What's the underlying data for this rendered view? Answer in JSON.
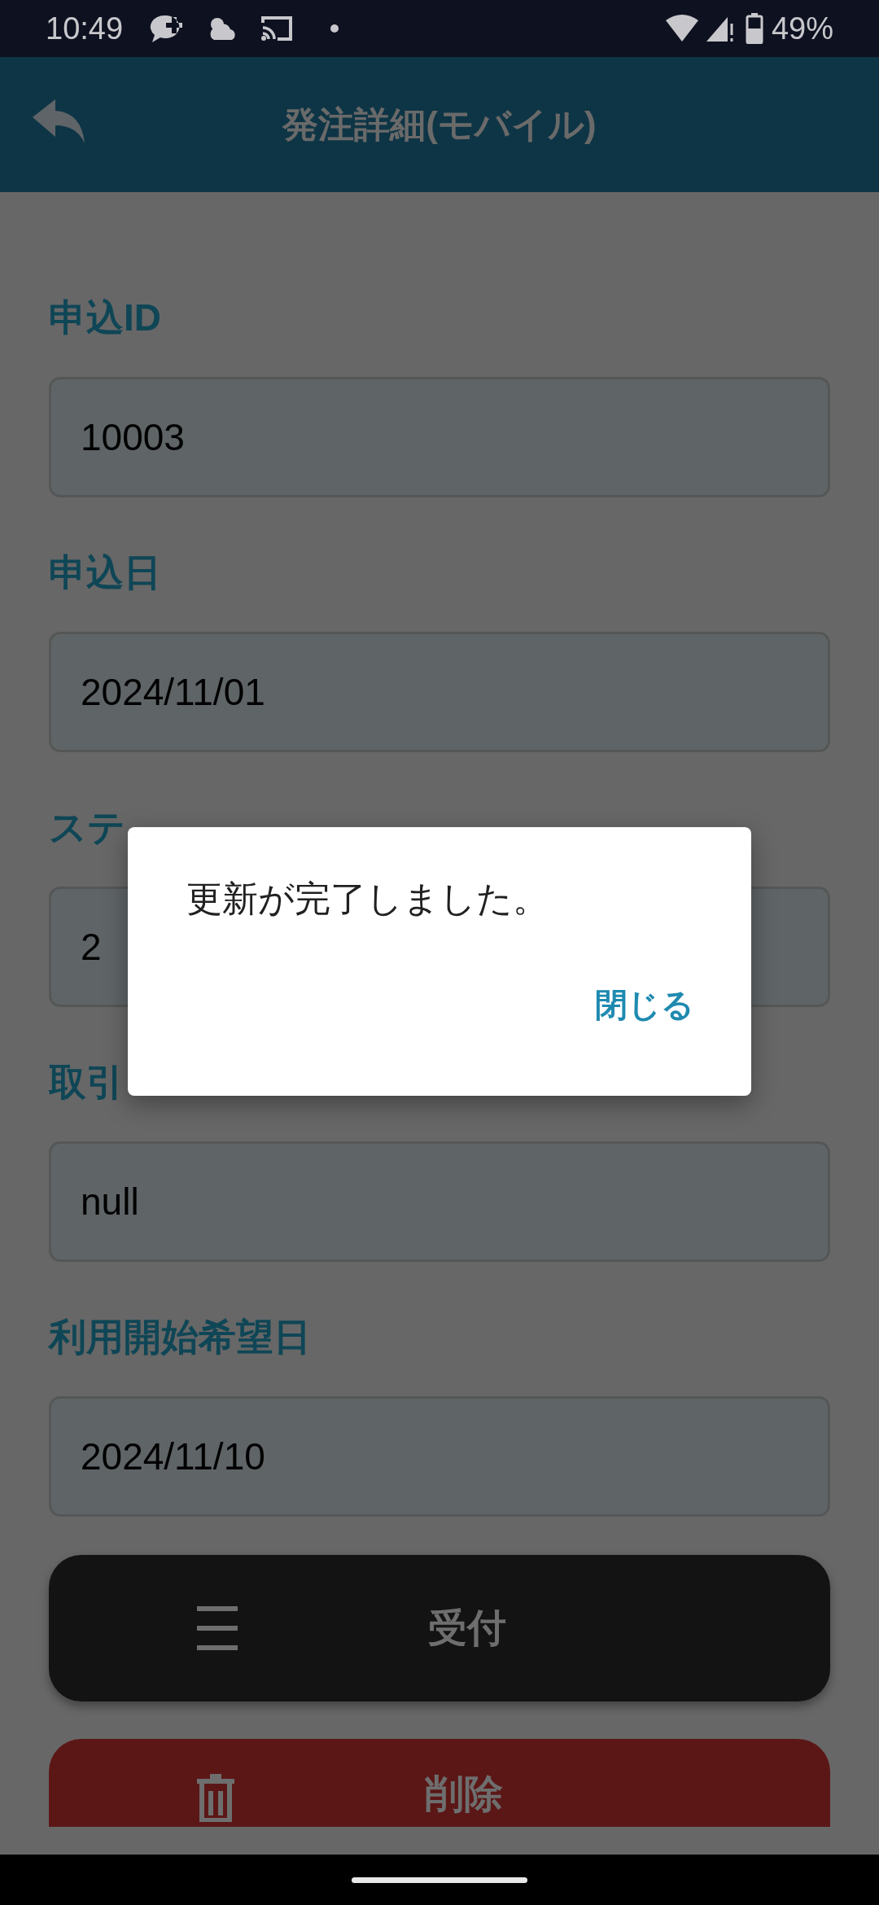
{
  "status_bar": {
    "time": "10:49",
    "battery": "49%"
  },
  "header": {
    "title": "発注詳細(モバイル)"
  },
  "fields": [
    {
      "label": "申込ID",
      "value": "10003"
    },
    {
      "label": "申込日",
      "value": "2024/11/01"
    },
    {
      "label": "ステ",
      "value": "2"
    },
    {
      "label": "取引",
      "value": "null"
    },
    {
      "label": "利用開始希望日",
      "value": "2024/11/10"
    }
  ],
  "buttons": [
    {
      "label": "受付",
      "kind": "accept"
    },
    {
      "label": "削除",
      "kind": "delete"
    }
  ],
  "dialog": {
    "message": "更新が完了しました。",
    "button": "閉じる"
  }
}
